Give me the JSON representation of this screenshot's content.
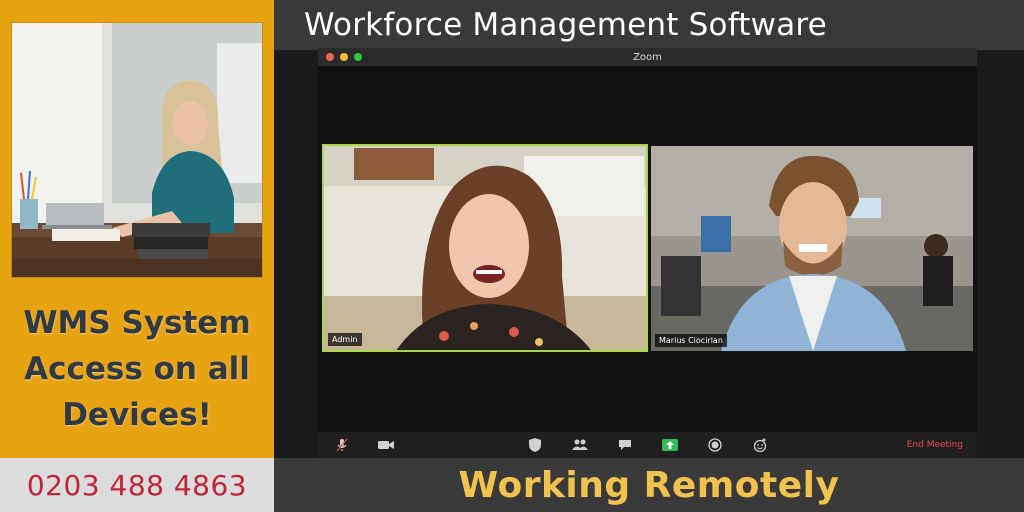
{
  "left_panel": {
    "headline_lines": [
      "WMS System",
      "Access on all",
      "Devices!"
    ],
    "phone": "0203 488 4863"
  },
  "header": {
    "title": "Workforce Management Software"
  },
  "zoom": {
    "window_title": "Zoom",
    "participants": [
      {
        "name": "Admin"
      },
      {
        "name": "Marius Ciocirlan"
      }
    ],
    "toolbar": {
      "end_meeting_label": "End Meeting"
    }
  },
  "footer": {
    "title": "Working Remotely"
  },
  "colors": {
    "accent_orange": "#e8a313",
    "title_bar": "#393939",
    "phone_red": "#c0243a",
    "footer_yellow": "#f1c24d",
    "active_speaker": "#a8d64b",
    "end_meeting_red": "#e5484d"
  }
}
